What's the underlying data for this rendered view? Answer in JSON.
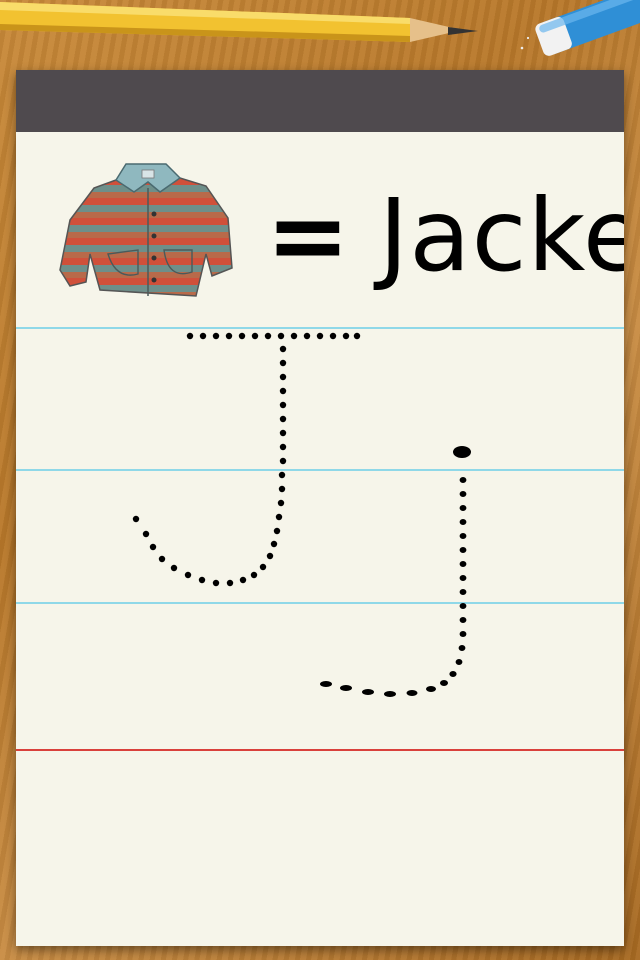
{
  "app": {
    "word_label": "Jacket",
    "equals_sign": "=",
    "picture_icon": "jacket-icon",
    "letter_uppercase": "J",
    "letter_lowercase": "j"
  },
  "colors": {
    "paper": "#f6f5ea",
    "binding": "#4f4a4e",
    "guide_line": "#8fd8e8",
    "margin_line": "#d9403c",
    "trace_dots": "#000000"
  }
}
